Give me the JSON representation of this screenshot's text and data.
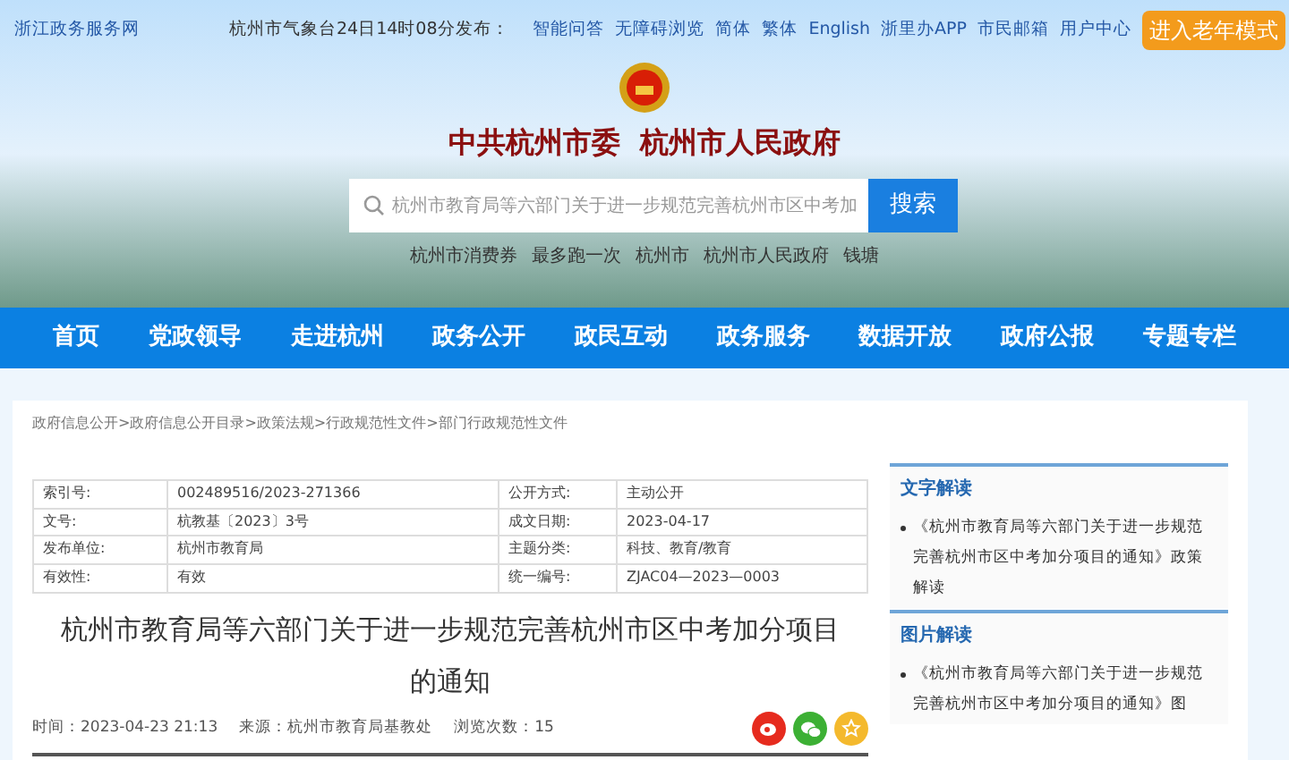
{
  "top_bar": {
    "site": "浙江政务服务网",
    "weather": "杭州市气象台24日14时08分发布：",
    "links": [
      "智能问答",
      "无障碍浏览",
      "简体",
      "繁体",
      "English",
      "浙里办APP",
      "市民邮箱",
      "用户中心"
    ],
    "elder_button": "进入老年模式"
  },
  "header": {
    "title": "中共杭州市委  杭州市人民政府",
    "search": {
      "value": "杭州市教育局等六部门关于进一步规范完善杭州市区中考加",
      "button": "搜索"
    },
    "hot_words": [
      "杭州市消费券",
      "最多跑一次",
      "杭州市",
      "杭州市人民政府",
      "钱塘"
    ]
  },
  "nav": [
    "首页",
    "党政领导",
    "走进杭州",
    "政务公开",
    "政民互动",
    "政务服务",
    "数据开放",
    "政府公报",
    "专题专栏"
  ],
  "breadcrumb_separator": ">",
  "breadcrumb": [
    "政府信息公开",
    "政府信息公开目录",
    "政策法规",
    "行政规范性文件",
    "部门行政规范性文件"
  ],
  "info_table": [
    [
      "索引号:",
      "002489516/2023-271366",
      "公开方式:",
      "主动公开"
    ],
    [
      "文号:",
      "杭教基〔2023〕3号",
      "成文日期:",
      "2023-04-17"
    ],
    [
      "发布单位:",
      "杭州市教育局",
      "主题分类:",
      "科技、教育/教育"
    ],
    [
      "有效性:",
      "有效",
      "统一编号:",
      "ZJAC04—2023—0003"
    ]
  ],
  "article": {
    "title": "杭州市教育局等六部门关于进一步规范完善杭州市区中考加分项目的通知",
    "time": "时间：2023-04-23 21:13",
    "source": "来源：杭州市教育局基教处",
    "views": "浏览次数：15"
  },
  "sidebar": [
    {
      "heading": "文字解读",
      "items": [
        "《杭州市教育局等六部门关于进一步规范完善杭州市区中考加分项目的通知》政策解读"
      ]
    },
    {
      "heading": "图片解读",
      "items": [
        "《杭州市教育局等六部门关于进一步规范完善杭州市区中考加分项目的通知》图"
      ]
    }
  ]
}
